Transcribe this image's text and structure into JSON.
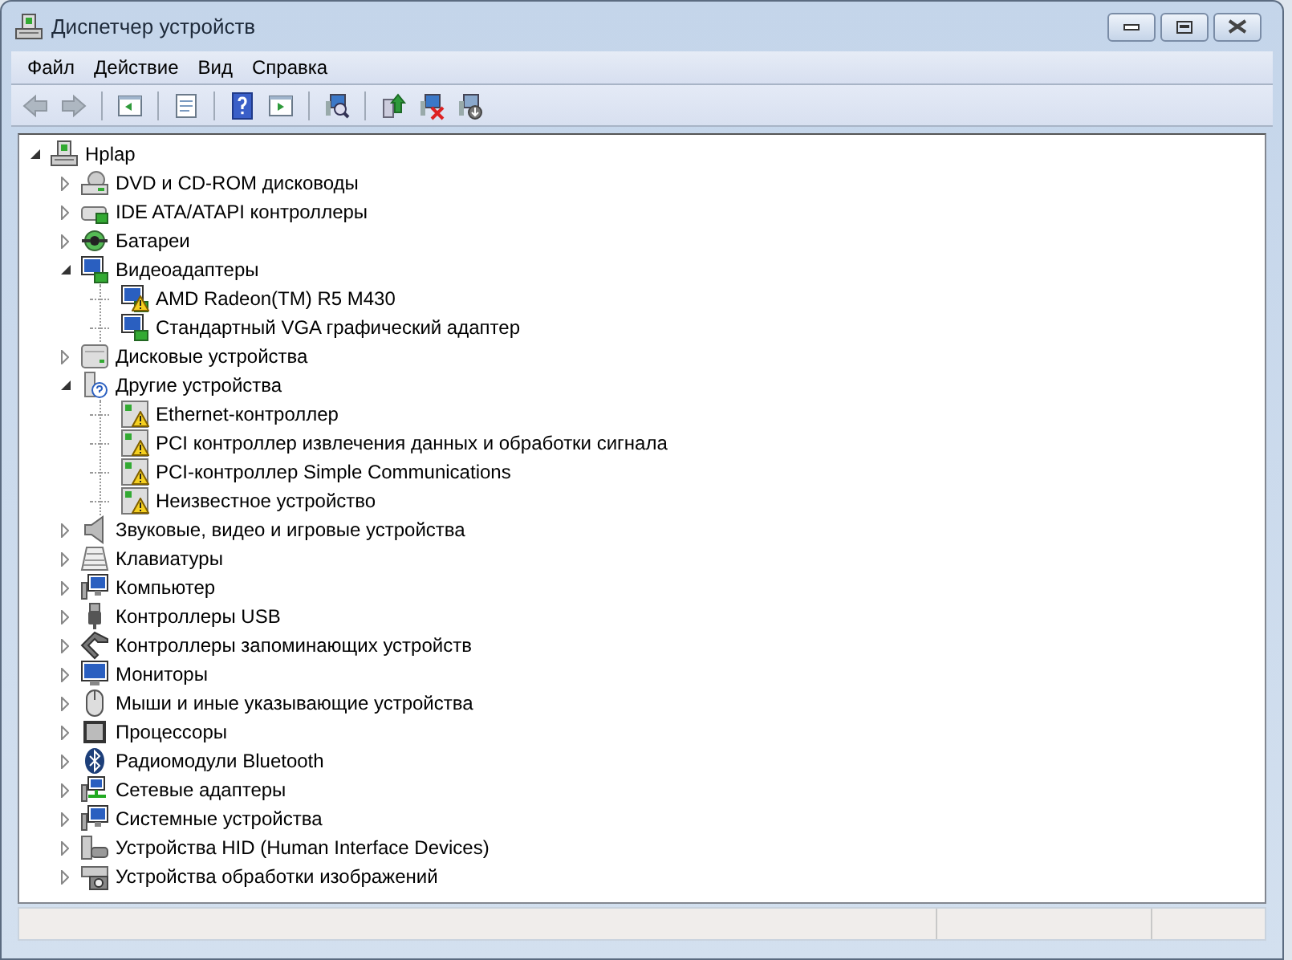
{
  "window": {
    "title": "Диспетчер устройств"
  },
  "menu": [
    {
      "label": "Файл"
    },
    {
      "label": "Действие"
    },
    {
      "label": "Вид"
    },
    {
      "label": "Справка"
    }
  ],
  "toolbar": [
    {
      "kind": "back",
      "disabled": true
    },
    {
      "kind": "forward",
      "disabled": true
    },
    {
      "kind": "separator"
    },
    {
      "kind": "console-tree",
      "disabled": false
    },
    {
      "kind": "separator"
    },
    {
      "kind": "properties",
      "disabled": false
    },
    {
      "kind": "separator"
    },
    {
      "kind": "help",
      "disabled": false
    },
    {
      "kind": "action-pane",
      "disabled": false
    },
    {
      "kind": "separator"
    },
    {
      "kind": "scan",
      "disabled": false
    },
    {
      "kind": "separator"
    },
    {
      "kind": "update",
      "disabled": false
    },
    {
      "kind": "disable",
      "disabled": false
    },
    {
      "kind": "uninstall",
      "disabled": false
    }
  ],
  "tree": {
    "label": "Hplap",
    "kind": "computer",
    "expanded": true,
    "children": [
      {
        "label": "DVD и CD-ROM дисководы",
        "kind": "disc",
        "expanded": false
      },
      {
        "label": "IDE ATA/ATAPI контроллеры",
        "kind": "ide",
        "expanded": false
      },
      {
        "label": "Батареи",
        "kind": "battery",
        "expanded": false
      },
      {
        "label": "Видеоадаптеры",
        "kind": "display",
        "expanded": true,
        "children": [
          {
            "label": "AMD Radeon(TM) R5 M430",
            "kind": "display",
            "warning": true
          },
          {
            "label": "Стандартный VGA графический адаптер",
            "kind": "display",
            "warning": false
          }
        ]
      },
      {
        "label": "Дисковые устройства",
        "kind": "disk",
        "expanded": false
      },
      {
        "label": "Другие устройства",
        "kind": "unknown",
        "expanded": true,
        "children": [
          {
            "label": "Ethernet-контроллер",
            "kind": "device",
            "warning": true
          },
          {
            "label": "PCI контроллер извлечения данных и обработки сигнала",
            "kind": "device",
            "warning": true
          },
          {
            "label": "PCI-контроллер Simple Communications",
            "kind": "device",
            "warning": true
          },
          {
            "label": "Неизвестное устройство",
            "kind": "device",
            "warning": true
          }
        ]
      },
      {
        "label": "Звуковые, видео и игровые устройства",
        "kind": "sound",
        "expanded": false
      },
      {
        "label": "Клавиатуры",
        "kind": "keyboard",
        "expanded": false
      },
      {
        "label": "Компьютер",
        "kind": "system",
        "expanded": false
      },
      {
        "label": "Контроллеры USB",
        "kind": "usb",
        "expanded": false
      },
      {
        "label": "Контроллеры запоминающих устройств",
        "kind": "storage",
        "expanded": false
      },
      {
        "label": "Мониторы",
        "kind": "monitor",
        "expanded": false
      },
      {
        "label": "Мыши и иные указывающие устройства",
        "kind": "mouse",
        "expanded": false
      },
      {
        "label": "Процессоры",
        "kind": "cpu",
        "expanded": false
      },
      {
        "label": "Радиомодули Bluetooth",
        "kind": "bluetooth",
        "expanded": false
      },
      {
        "label": "Сетевые адаптеры",
        "kind": "network",
        "expanded": false
      },
      {
        "label": "Системные устройства",
        "kind": "system",
        "expanded": false
      },
      {
        "label": "Устройства HID (Human Interface Devices)",
        "kind": "hid",
        "expanded": false
      },
      {
        "label": "Устройства обработки изображений",
        "kind": "camera",
        "expanded": false
      }
    ]
  }
}
